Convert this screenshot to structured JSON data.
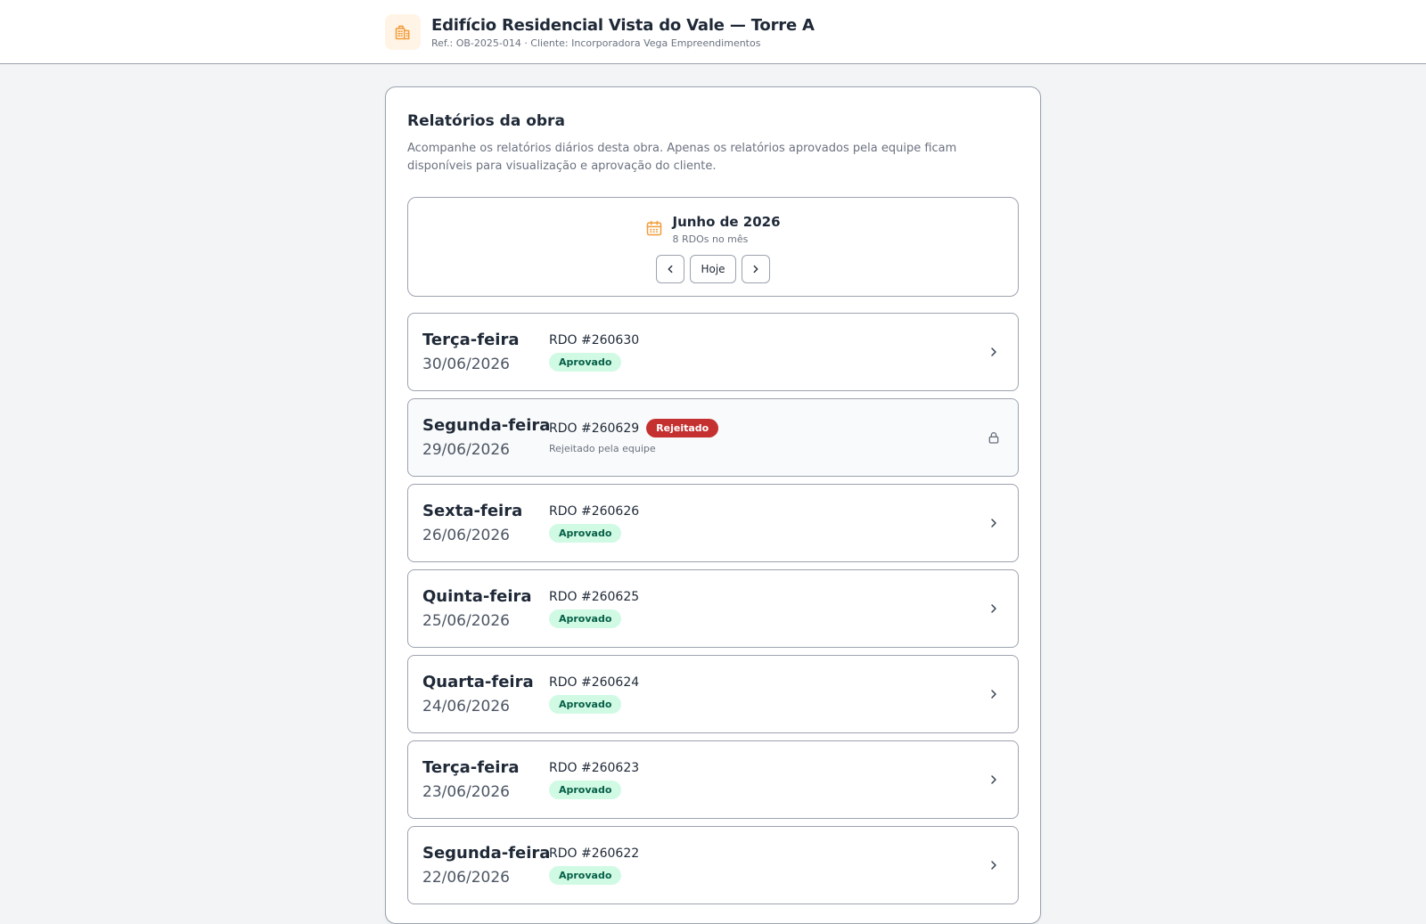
{
  "header": {
    "title": "Edifício Residencial Vista do Vale — Torre A",
    "subtitle": "Ref.: OB-2025-014 · Cliente: Incorporadora Vega Empreendimentos",
    "logo_icon": "building-icon"
  },
  "reports": {
    "title": "Relatórios da obra",
    "description": "Acompanhe os relatórios diários desta obra. Apenas os relatórios aprovados pela equipe ficam disponíveis para visualização e aprovação do cliente.",
    "month": {
      "name": "Junho de 2026",
      "count": "8 RDOs no mês",
      "prev_icon": "chevron-left-icon",
      "today_label": "Hoje",
      "next_icon": "chevron-right-icon"
    },
    "items": [
      {
        "day": "Terça-feira",
        "date": "30/06/2026",
        "number": "RDO #260630",
        "status": "Aprovado",
        "state": "approved"
      },
      {
        "day": "Segunda-feira",
        "date": "29/06/2026",
        "number": "RDO #260629",
        "status": "Rejeitado",
        "state": "rejected",
        "note": "Rejeitado pela equipe"
      },
      {
        "day": "Sexta-feira",
        "date": "26/06/2026",
        "number": "RDO #260626",
        "status": "Aprovado",
        "state": "approved"
      },
      {
        "day": "Quinta-feira",
        "date": "25/06/2026",
        "number": "RDO #260625",
        "status": "Aprovado",
        "state": "approved"
      },
      {
        "day": "Quarta-feira",
        "date": "24/06/2026",
        "number": "RDO #260624",
        "status": "Aprovado",
        "state": "approved"
      },
      {
        "day": "Terça-feira",
        "date": "23/06/2026",
        "number": "RDO #260623",
        "status": "Aprovado",
        "state": "approved"
      },
      {
        "day": "Segunda-feira",
        "date": "22/06/2026",
        "number": "RDO #260622",
        "status": "Aprovado",
        "state": "approved"
      }
    ]
  },
  "colors": {
    "accent": "#f29c38",
    "approved_bg": "#d1fae5",
    "approved_text": "#065f46",
    "rejected_bg": "#c53030"
  }
}
